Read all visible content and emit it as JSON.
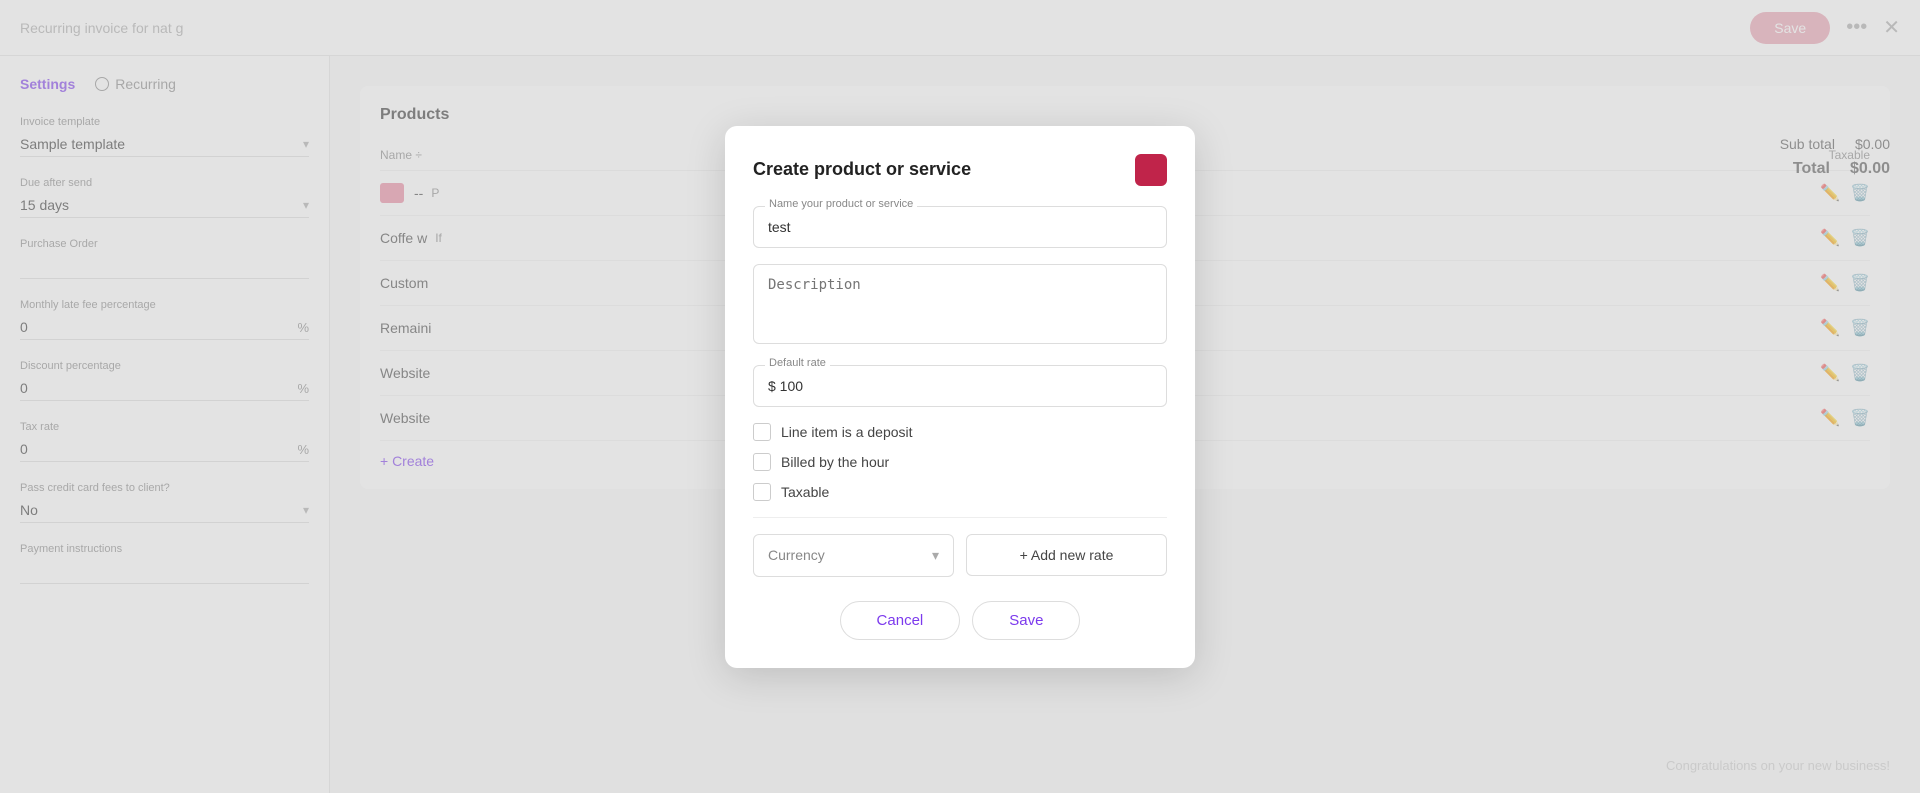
{
  "topbar": {
    "title": "Recurring invoice for nat g",
    "save_label": "Save",
    "dots": "•••",
    "close": "✕"
  },
  "sidebar": {
    "tabs": [
      {
        "id": "settings",
        "label": "Settings",
        "active": true
      },
      {
        "id": "recurring",
        "label": "Recurring",
        "active": false
      }
    ],
    "fields": [
      {
        "label": "Invoice template",
        "value": "Sample template",
        "type": "dropdown"
      },
      {
        "label": "Due after send",
        "value": "15 days",
        "type": "dropdown"
      },
      {
        "label": "Purchase Order",
        "value": "",
        "type": "text"
      },
      {
        "label": "Monthly late fee percentage",
        "value": "0",
        "suffix": "%",
        "type": "number"
      },
      {
        "label": "Discount percentage",
        "value": "0",
        "suffix": "%",
        "type": "number"
      },
      {
        "label": "Tax rate",
        "value": "0",
        "suffix": "%",
        "type": "number"
      },
      {
        "label": "Pass credit card fees to client?",
        "value": "No",
        "type": "dropdown"
      },
      {
        "label": "Payment instructions",
        "value": "",
        "type": "text"
      }
    ]
  },
  "main": {
    "section_title": "Products",
    "table_headers": [
      "Name ÷",
      "Taxable"
    ],
    "rows": [
      {
        "icon": true,
        "name": "--",
        "extra": "P"
      },
      {
        "icon": false,
        "name": "Coffe w",
        "note": "If"
      },
      {
        "icon": false,
        "name": "Custom",
        "note": ""
      },
      {
        "icon": false,
        "name": "Remaini",
        "note": ""
      },
      {
        "icon": false,
        "name": "Website",
        "note": ""
      },
      {
        "icon": false,
        "name": "Website",
        "note": ""
      }
    ],
    "create_link": "+ Create"
  },
  "totals": {
    "sub_total_label": "Sub total",
    "sub_total_value": "$0.00",
    "total_label": "Total",
    "total_value": "$0.00"
  },
  "modal": {
    "title": "Create product or service",
    "name_label": "Name your product or service",
    "name_value": "test",
    "description_label": "Description",
    "description_placeholder": "Description",
    "rate_label": "Default rate",
    "rate_value": "$ 100",
    "checkboxes": [
      {
        "id": "deposit",
        "label": "Line item is a deposit",
        "checked": false
      },
      {
        "id": "hour",
        "label": "Billed by the hour",
        "checked": false
      },
      {
        "id": "taxable",
        "label": "Taxable",
        "checked": false
      }
    ],
    "currency_label": "Currency",
    "currency_placeholder": "Currency",
    "add_rate_label": "+ Add new rate",
    "cancel_label": "Cancel",
    "save_label": "Save"
  },
  "congrats": "Congratulations on your new business!"
}
